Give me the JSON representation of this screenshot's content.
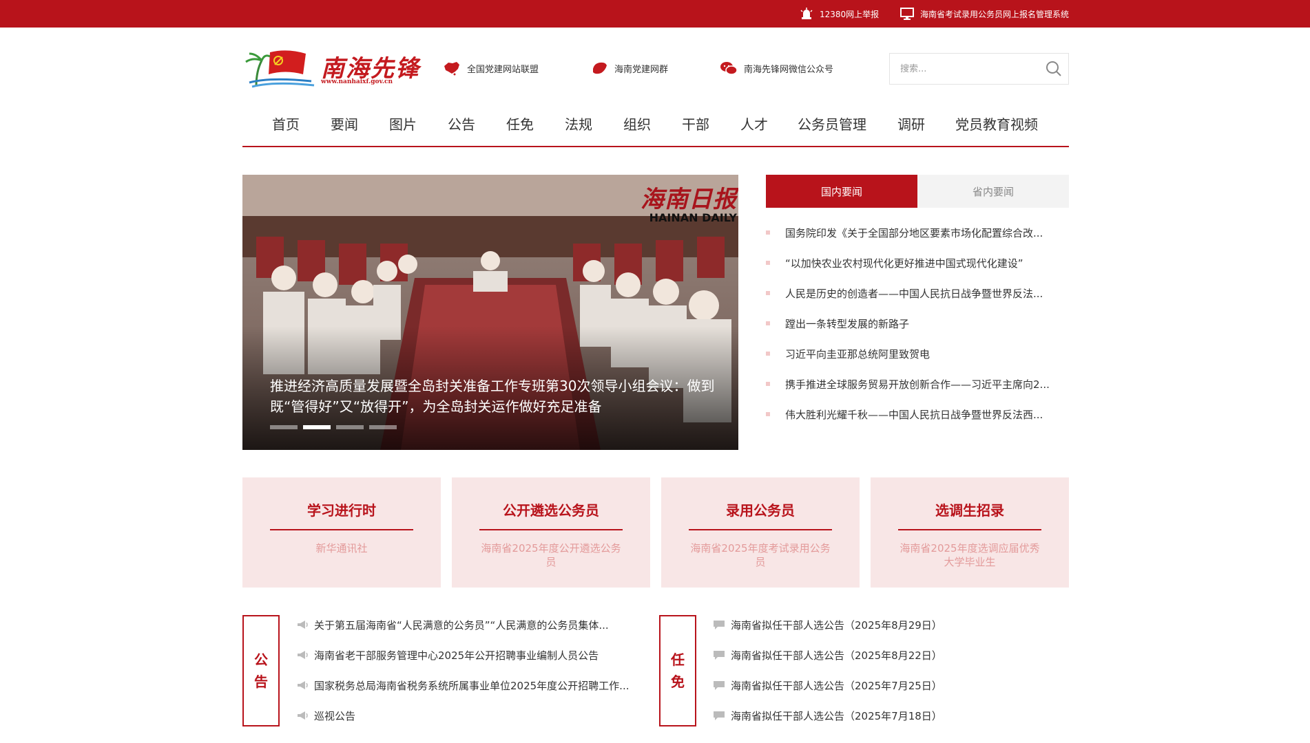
{
  "topbar": {
    "links": [
      {
        "label": "12380网上举报",
        "icon": "alarm-icon"
      },
      {
        "label": "海南省考试录用公务员网上报名管理系统",
        "icon": "monitor-icon"
      }
    ]
  },
  "header": {
    "logo_text": "南海先锋",
    "logo_url": "www.nanhaixf.gov.cn",
    "quick_links": [
      {
        "label": "全国党建网站联盟",
        "icon": "china-map-icon"
      },
      {
        "label": "海南党建网群",
        "icon": "hainan-map-icon"
      },
      {
        "label": "南海先锋网微信公众号",
        "icon": "wechat-icon"
      }
    ],
    "search_placeholder": "搜索..."
  },
  "nav": {
    "items": [
      "首页",
      "要闻",
      "图片",
      "公告",
      "任免",
      "法规",
      "组织",
      "干部",
      "人才",
      "公务员管理",
      "调研",
      "党员教育视频"
    ]
  },
  "slider": {
    "caption": "推进经济高质量发展暨全岛封关准备工作专班第30次领导小组会议：做到既“管得好”又“放得开”，为全岛封关运作做好充足准备",
    "watermark_cn": "海南日报",
    "watermark_en": "HAINAN DAILY",
    "slide_count": 4,
    "active_slide": 2
  },
  "news": {
    "tabs": [
      {
        "label": "国内要闻",
        "active": true
      },
      {
        "label": "省内要闻",
        "active": false
      }
    ],
    "items": [
      "国务院印发《关于全国部分地区要素市场化配置综合改...",
      "“以加快农业农村现代化更好推进中国式现代化建设”",
      "人民是历史的创造者——中国人民抗日战争暨世界反法...",
      "蹚出一条转型发展的新路子",
      "习近平向圭亚那总统阿里致贺电",
      "携手推进全球服务贸易开放创新合作——习近平主席向2...",
      "伟大胜利光耀千秋——中国人民抗日战争暨世界反法西..."
    ]
  },
  "cards": [
    {
      "title": "学习进行时",
      "desc": "新华通讯社"
    },
    {
      "title": "公开遴选公务员",
      "desc": "海南省2025年度公开遴选公务员"
    },
    {
      "title": "录用公务员",
      "desc": "海南省2025年度考试录用公务员"
    },
    {
      "title": "选调生招录",
      "desc": "海南省2025年度选调应届优秀大学毕业生"
    }
  ],
  "announcements": {
    "label_top": "公",
    "label_bottom": "告",
    "items": [
      "关于第五届海南省“人民满意的公务员”“人民满意的公务员集体...",
      "海南省老干部服务管理中心2025年公开招聘事业编制人员公告",
      "国家税务总局海南省税务系统所属事业单位2025年度公开招聘工作...",
      "巡视公告"
    ]
  },
  "appointments": {
    "label_top": "任",
    "label_bottom": "免",
    "items": [
      "海南省拟任干部人选公告（2025年8月29日）",
      "海南省拟任干部人选公告（2025年8月22日）",
      "海南省拟任干部人选公告（2025年7月25日）",
      "海南省拟任干部人选公告（2025年7月18日）"
    ]
  },
  "colors": {
    "brand_red": "#b8131b",
    "card_bg": "#f8e6e6",
    "card_desc": "#e39a9a"
  }
}
